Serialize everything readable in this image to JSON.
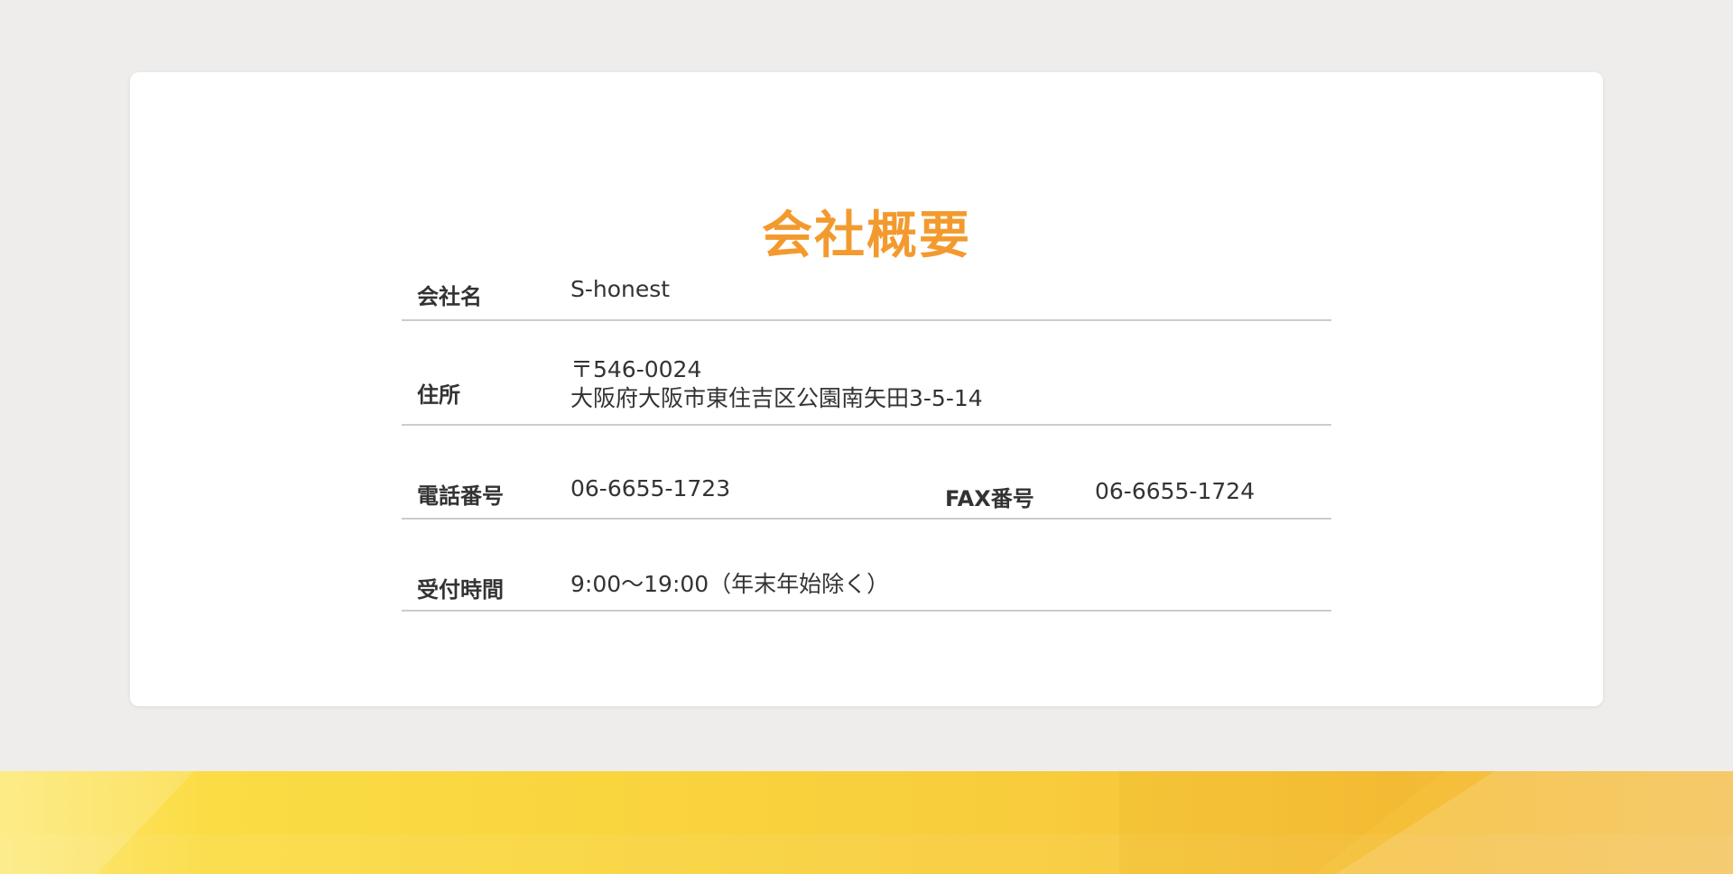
{
  "section": {
    "title": "会社概要"
  },
  "company": {
    "name_label": "会社名",
    "name_value": "S-honest",
    "address_label": "住所",
    "postal_code": "〒546-0024",
    "address_line": "大阪府大阪市東住吉区公園南矢田3-5-14",
    "tel_label": "電話番号",
    "tel_value": "06-6655-1723",
    "fax_label": "FAX番号",
    "fax_value": "06-6655-1724",
    "hours_label": "受付時間",
    "hours_value": "9:00〜19:00（年末年始除く）"
  },
  "colors": {
    "title": "#f39a2e",
    "background": "#eeedeb",
    "card": "#ffffff",
    "divider": "#cccccc",
    "footer_band": "#f9d53e"
  }
}
